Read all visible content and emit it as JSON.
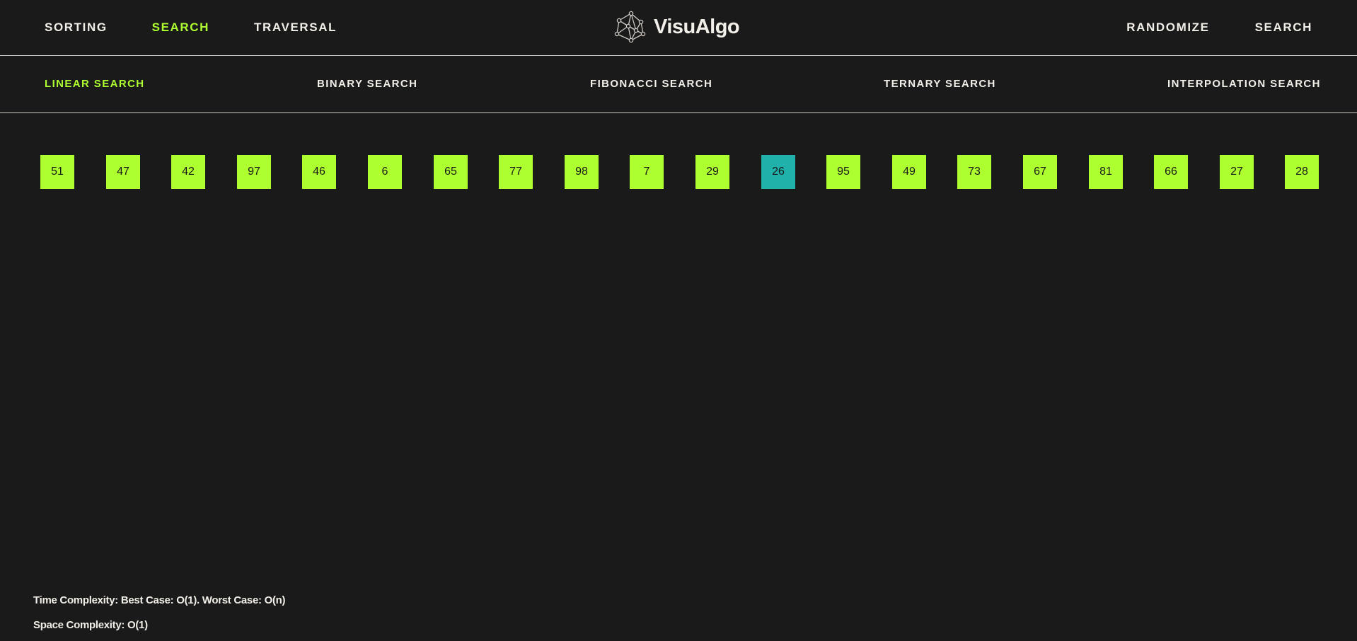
{
  "header": {
    "nav": [
      "SORTING",
      "SEARCH",
      "TRAVERSAL"
    ],
    "active_nav": "SEARCH",
    "brand": "VisuAlgo",
    "actions": [
      "RANDOMIZE",
      "SEARCH"
    ]
  },
  "algorithms": {
    "items": [
      "LINEAR SEARCH",
      "BINARY SEARCH",
      "FIBONACCI SEARCH",
      "TERNARY SEARCH",
      "INTERPOLATION SEARCH"
    ],
    "active": "LINEAR SEARCH"
  },
  "array": {
    "values": [
      "51",
      "47",
      "42",
      "97",
      "46",
      "6",
      "65",
      "77",
      "98",
      "7",
      "29",
      "26",
      "95",
      "49",
      "73",
      "67",
      "81",
      "66",
      "27",
      "28"
    ],
    "highlighted_value": "26"
  },
  "complexity": {
    "time": "Time Complexity: Best Case: O(1). Worst Case: O(n)",
    "space": "Space Complexity: O(1)"
  },
  "colors": {
    "background": "#1b1a1b",
    "text": "#f2eee8",
    "accent": "#adff2f",
    "highlight": "#20b2aa"
  },
  "icons": {
    "brand": "network-graph-icon"
  }
}
